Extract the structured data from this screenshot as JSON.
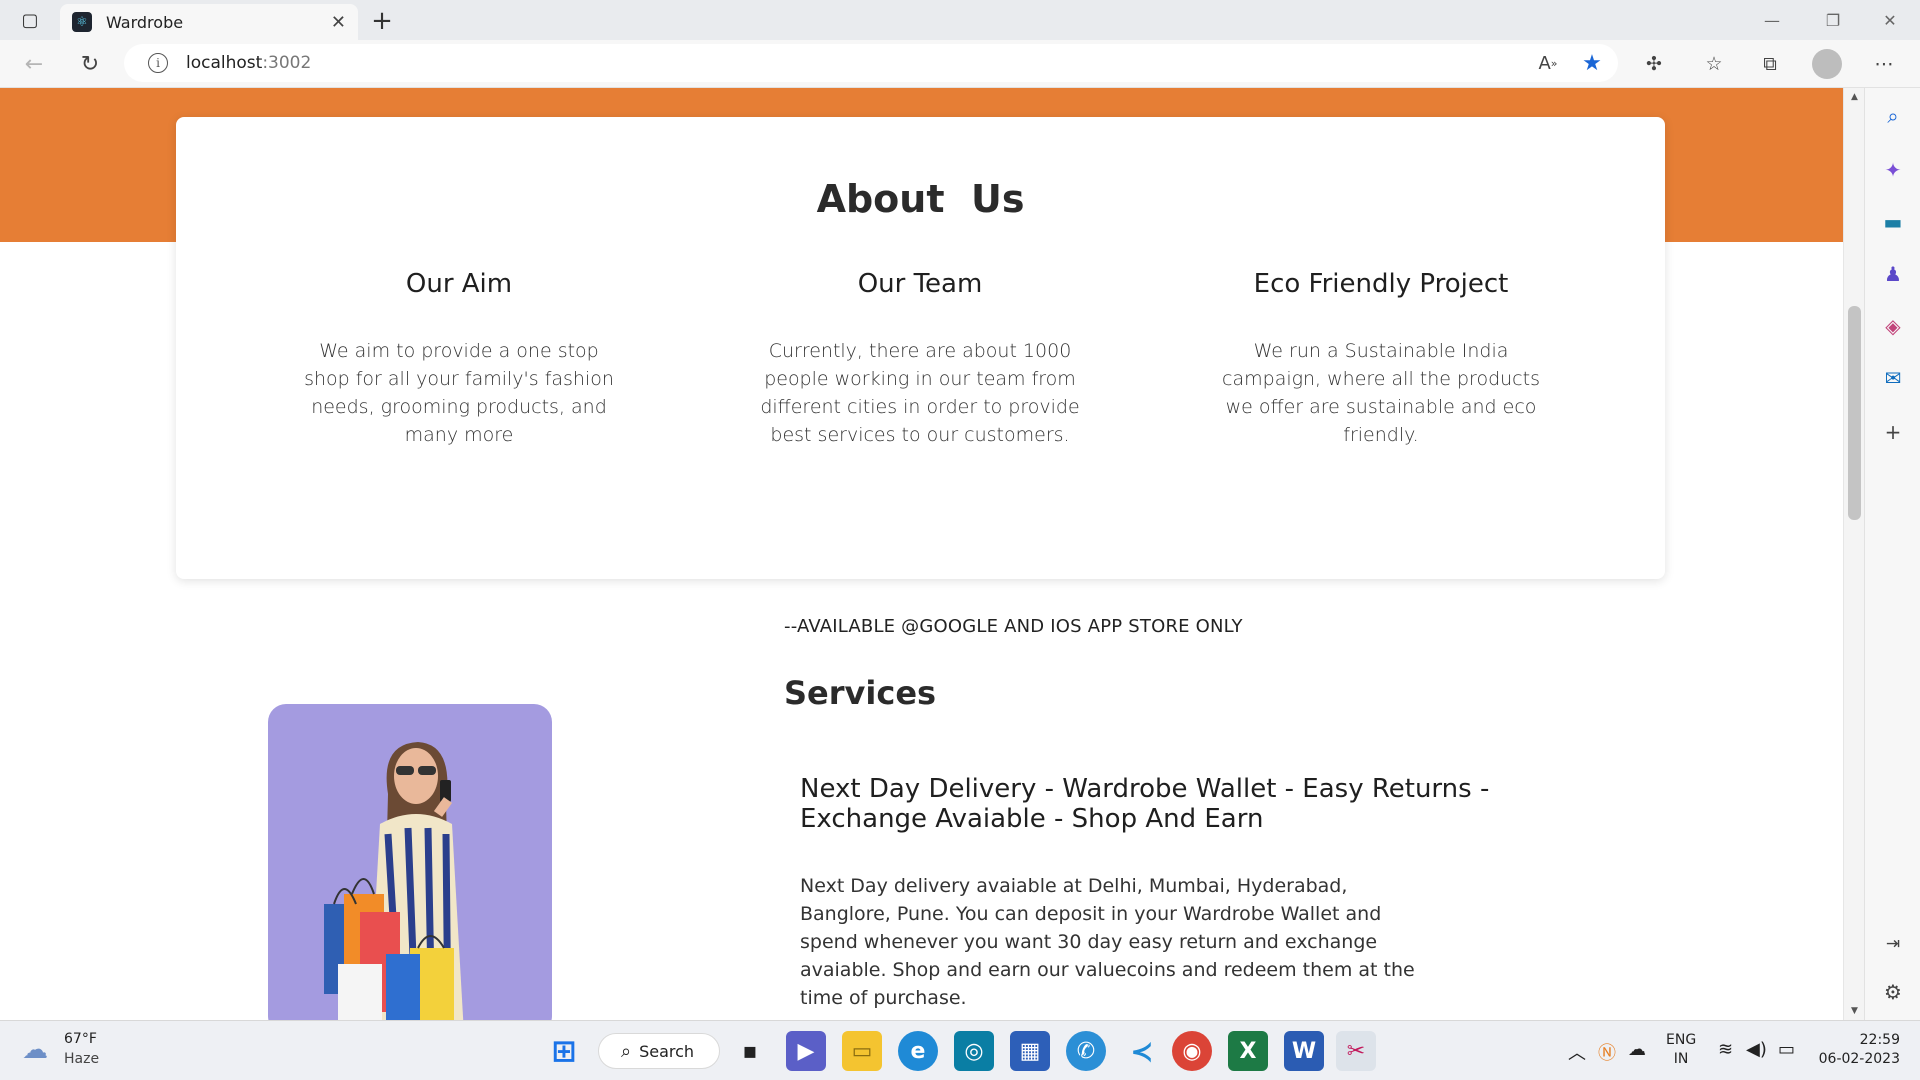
{
  "browser": {
    "tab_title": "Wardrobe",
    "url_host": "localhost",
    "url_port": ":3002",
    "tab_close_glyph": "✕",
    "new_tab_glyph": "+",
    "window_controls": [
      "—",
      "❐",
      "✕"
    ]
  },
  "about": {
    "title": "About  Us",
    "columns": [
      {
        "heading": "Our Aim",
        "text": "We aim to provide a one stop shop for all your family's fashion needs, grooming products, and many more"
      },
      {
        "heading": "Our Team",
        "text": "Currently, there are about 1000 people working in our team from different cities in order to provide best services to our customers."
      },
      {
        "heading": "Eco Friendly Project",
        "text": "We run a Sustainable India campaign, where all the products we offer are sustainable and eco friendly."
      }
    ]
  },
  "services": {
    "availability": "--AVAILABLE @GOOGLE AND IOS APP STORE ONLY",
    "title": "Services",
    "subtitle": "Next Day Delivery - Wardrobe Wallet - Easy Returns - Exchange Avaiable - Shop And Earn",
    "description": "Next Day delivery avaiable at Delhi, Mumbai, Hyderabad, Banglore, Pune. You can deposit in your Wardrobe Wallet and spend whenever you want 30 day easy return and exchange avaiable. Shop and earn our valuecoins and redeem them at the time of purchase."
  },
  "taskbar": {
    "weather_temp": "67°F",
    "weather_desc": "Haze",
    "search_label": "Search",
    "lang_line1": "ENG",
    "lang_line2": "IN",
    "time": "22:59",
    "date": "06-02-2023"
  },
  "colors": {
    "accent_orange": "#e67e35",
    "hero_bg": "#a49be0",
    "favorite_star": "#1a66d6"
  },
  "icons": {
    "sidebar": [
      "search-icon",
      "copilot-icon",
      "tools-icon",
      "games-icon",
      "office-icon",
      "outlook-icon",
      "add-icon"
    ],
    "taskbar_apps": [
      "windows-start-icon",
      "task-view-icon",
      "teams-icon",
      "file-explorer-icon",
      "edge-icon",
      "app-icon",
      "store-icon",
      "app-icon-2",
      "vscode-icon",
      "chrome-icon",
      "excel-icon",
      "word-icon",
      "snipping-tool-icon"
    ]
  }
}
